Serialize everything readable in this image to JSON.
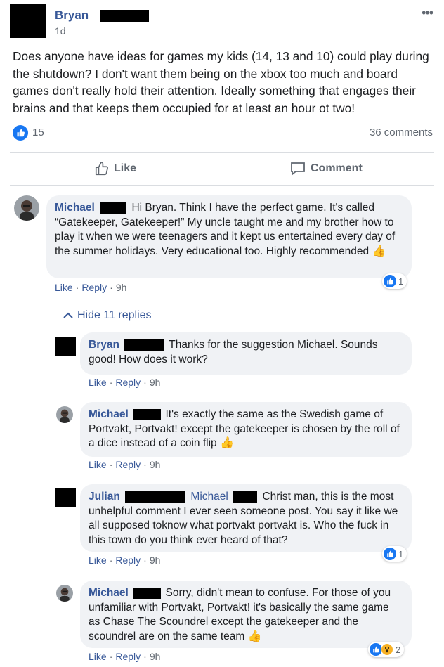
{
  "post": {
    "author": "Bryan",
    "time": "1d",
    "more": "•••",
    "text": "Does anyone have ideas for games my kids (14, 13 and 10) could play during the shutdown? I don't want them being on the xbox too much and board games don't really hold their attention. Ideally something that engages their brains and that keeps them occupied for at least an hour ot two!",
    "like_count": "15",
    "comments_count": "36 comments",
    "like_label": "Like",
    "comment_label": "Comment"
  },
  "comments": [
    {
      "author": "Michael",
      "text": "Hi Bryan. Think I have the perfect game. It's called “Gatekeeper, Gatekeeper!” My uncle taught me and my brother how to play it when we were teenagers and it kept us entertained every day of the summer holidays. Very educational too. Highly recommended",
      "like": "Like",
      "reply": "Reply",
      "time": "9h",
      "reactions": "1"
    }
  ],
  "hide_replies": "Hide 11 replies",
  "replies": [
    {
      "author": "Bryan",
      "text": "Thanks for the suggestion Michael. Sounds good! How does it work?",
      "like": "Like",
      "reply": "Reply",
      "time": "9h"
    },
    {
      "author": "Michael",
      "text": "It's exactly the same as the Swedish game of Portvakt, Portvakt! except the gatekeeper is chosen by the roll of a dice instead of a coin flip",
      "like": "Like",
      "reply": "Reply",
      "time": "9h"
    },
    {
      "author": "Julian",
      "mention": "Michael",
      "text": "Christ man, this is the most unhelpful comment I ever seen someone post. You say it like we all supposed toknow what portvakt portvakt is. Who the fuck in this town do you think ever heard of that?",
      "like": "Like",
      "reply": "Reply",
      "time": "9h",
      "reactions": "1"
    },
    {
      "author": "Michael",
      "text": "Sorry, didn't mean to confuse. For those of you unfamiliar with Portvakt, Portvakt! it's basically the same game as Chase The Scoundrel except the gatekeeper and the scoundrel are on the same team",
      "like": "Like",
      "reply": "Reply",
      "time": "9h",
      "reactions": "2"
    }
  ],
  "colors": {
    "link": "#385898",
    "like_blue": "#1877f2",
    "bubble": "#f0f2f5",
    "meta": "#606770"
  }
}
